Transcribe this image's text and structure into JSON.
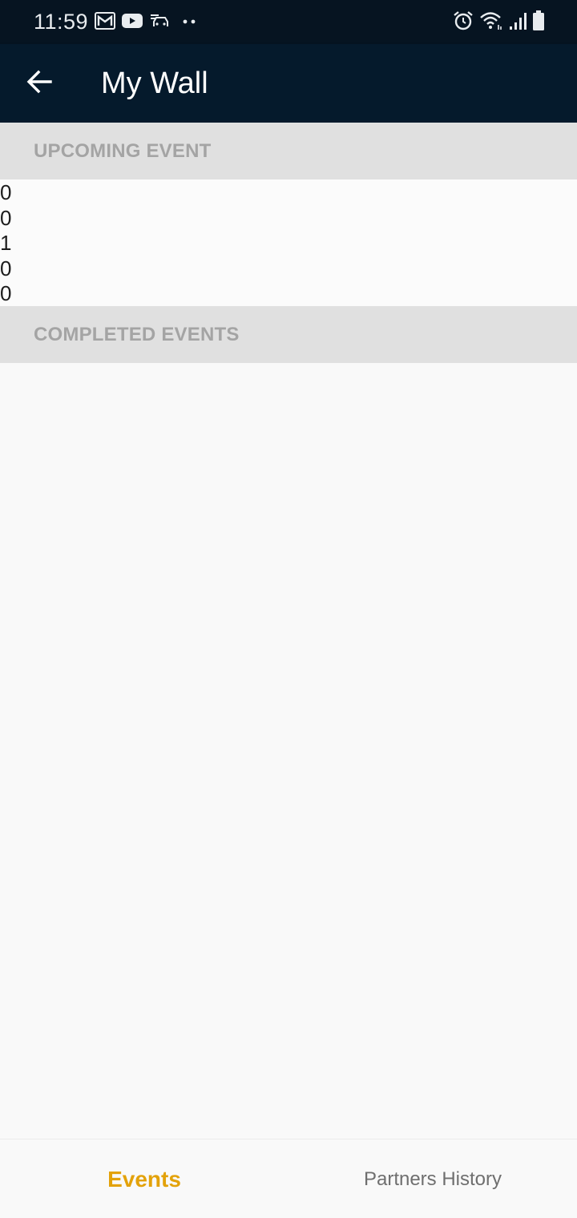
{
  "status_bar": {
    "time": "11:59",
    "left_icons": [
      "gmail-icon",
      "youtube-icon",
      "car-mode-icon",
      "more-dots-icon"
    ],
    "right_icons": [
      "alarm-icon",
      "wifi-icon",
      "signal-icon",
      "battery-icon"
    ]
  },
  "app_bar": {
    "back_icon": "arrow-back-icon",
    "title": "My Wall"
  },
  "sections": {
    "upcoming_title": "UPCOMING EVENT",
    "upcoming_values": [
      "0",
      "0",
      "1",
      "0",
      "0"
    ],
    "completed_title": "COMPLETED EVENTS"
  },
  "bottom_nav": {
    "events_label": "Events",
    "partners_label": "Partners History"
  },
  "colors": {
    "status_bar": "#061421",
    "app_bar": "#051a2c",
    "section_header_bg": "#e0e0e0",
    "section_header_text": "#a4a4a4",
    "active_tab": "#e3a20a",
    "inactive_tab": "#6f6f6f"
  }
}
